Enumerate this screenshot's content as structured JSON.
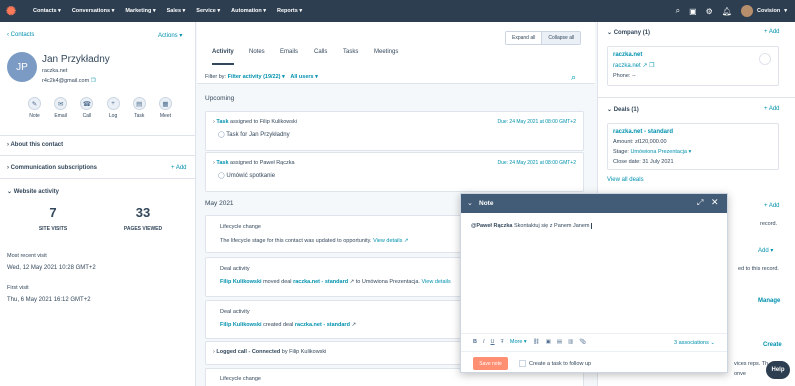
{
  "nav": {
    "items": [
      "Contacts",
      "Conversations",
      "Marketing",
      "Sales",
      "Service",
      "Automation",
      "Reports"
    ],
    "account": "Covision"
  },
  "contact": {
    "back": "Contacts",
    "actions": "Actions",
    "initials": "JP",
    "name": "Jan Przykładny",
    "company": "raczka.net",
    "email": "r4c2k4@gmail.com",
    "buttons": [
      "Note",
      "Email",
      "Call",
      "Log",
      "Task",
      "Meet"
    ]
  },
  "left_sections": {
    "about": "About this contact",
    "comm": "Communication subscriptions",
    "add": "+ Add",
    "website": "Website activity"
  },
  "website": {
    "visits": "7",
    "visits_label": "SITE VISITS",
    "pages": "33",
    "pages_label": "PAGES VIEWED",
    "recent_label": "Most recent visit",
    "recent_value": "Wed, 12 May 2021 10:28 GMT+2",
    "first_label": "First visit",
    "first_value": "Thu, 6 May 2021 16:12 GMT+2"
  },
  "tabs": [
    "Activity",
    "Notes",
    "Emails",
    "Calls",
    "Tasks",
    "Meetings"
  ],
  "expand": "Expand all",
  "collapse": "Collapse all",
  "filter": {
    "label": "Filter by:",
    "activity": "Filter activity (19/22)",
    "users": "All users"
  },
  "upcoming": "Upcoming",
  "task1": {
    "title": "Task",
    "assigned": "assigned to Filip Kulikowski",
    "due": "Due: 24 May 2021 at 08:00 GMT+2",
    "text": "Task for Jan Przykładny"
  },
  "task2": {
    "title": "Task",
    "assigned": "assigned to Paweł Rączka",
    "due": "Due: 24 May 2021 at 08:00 GMT+2",
    "text": "Umówić spotkanie"
  },
  "month": "May 2021",
  "lifecycle": {
    "title": "Lifecycle change",
    "text": "The lifecycle stage for this contact was updated to opportunity.",
    "link": "View details"
  },
  "deal1": {
    "title": "Deal activity",
    "user": "Filip Kulikowski",
    "verb": "moved deal",
    "deal": "raczka.net - standard",
    "rest": "to Umówiona Prezentacja.",
    "link": "View details"
  },
  "deal2": {
    "title": "Deal activity",
    "user": "Filip Kulikowski",
    "verb": "created deal",
    "deal": "raczka.net - standard"
  },
  "logged": {
    "title": "Logged call - Connected",
    "by": "by Filip Kulikowski"
  },
  "lifecycle2": {
    "title": "Lifecycle change"
  },
  "company": {
    "head": "Company (1)",
    "add": "+ Add",
    "name": "raczka.net",
    "link": "raczka.net",
    "phone": "Phone: --"
  },
  "deals": {
    "head": "Deals (1)",
    "add": "+ Add",
    "name": "raczka.net - standard",
    "amount": "Amount: zł120,000.00",
    "stage_label": "Stage:",
    "stage": "Umówiona Prezentacja",
    "close": "Close date: 31 July 2021",
    "view_all": "View all deals"
  },
  "right_misc": {
    "add3": "+ Add",
    "record1": "record.",
    "add4": "Add",
    "record2": "ed to this record.",
    "manage": "Manage",
    "create": "Create",
    "reps": "vices reps. Th",
    "onve": "onve"
  },
  "note": {
    "title": "Note",
    "mention": "@Paweł Rączka",
    "body": "Skontaktuj się z Panem Janem",
    "more": "More",
    "assoc": "3 associations",
    "save": "Save note",
    "followup": "Create a task to follow up"
  },
  "help": "Help"
}
